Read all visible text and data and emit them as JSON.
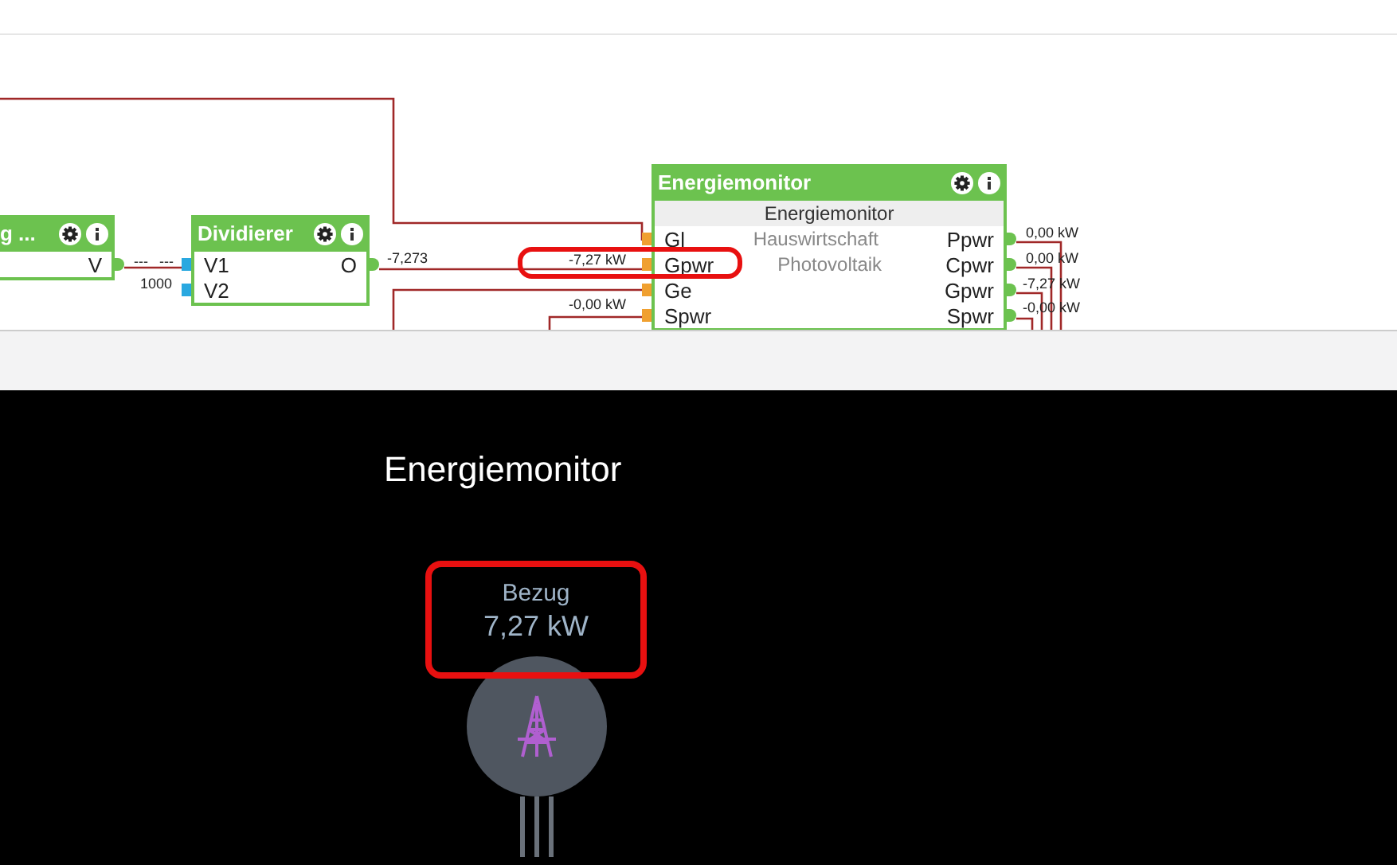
{
  "editor": {
    "nodes": [
      {
        "title": "g ...",
        "rows": [
          {
            "input": "",
            "middle": "",
            "output": "V"
          }
        ]
      },
      {
        "title": "Dividierer",
        "rows": [
          {
            "input": "V1",
            "middle": "",
            "output": "O"
          },
          {
            "input": "V2",
            "middle": "",
            "output": ""
          }
        ]
      },
      {
        "title": "Energiemonitor",
        "header_lines": [
          "Energiemonitor"
        ],
        "rows": [
          {
            "input": "Gl",
            "middle": "Hauswirtschaft",
            "output": "Ppwr"
          },
          {
            "input": "Gpwr",
            "middle": "Photovoltaik",
            "output": "Cpwr"
          },
          {
            "input": "Ge",
            "middle": "",
            "output": "Gpwr"
          },
          {
            "input": "Spwr",
            "middle": "",
            "output": "Spwr"
          }
        ]
      }
    ],
    "wire_labels": [
      "---",
      "---",
      "1000",
      "-7,273",
      "-7,27 kW",
      "-0,00 kW",
      "0,00 kW",
      "0,00 kW",
      "-7,27 kW",
      "-0,00 kW"
    ]
  },
  "card": {
    "title": "Energiemonitor",
    "grid": {
      "label": "Bezug",
      "value": "7,27 kW"
    }
  }
}
